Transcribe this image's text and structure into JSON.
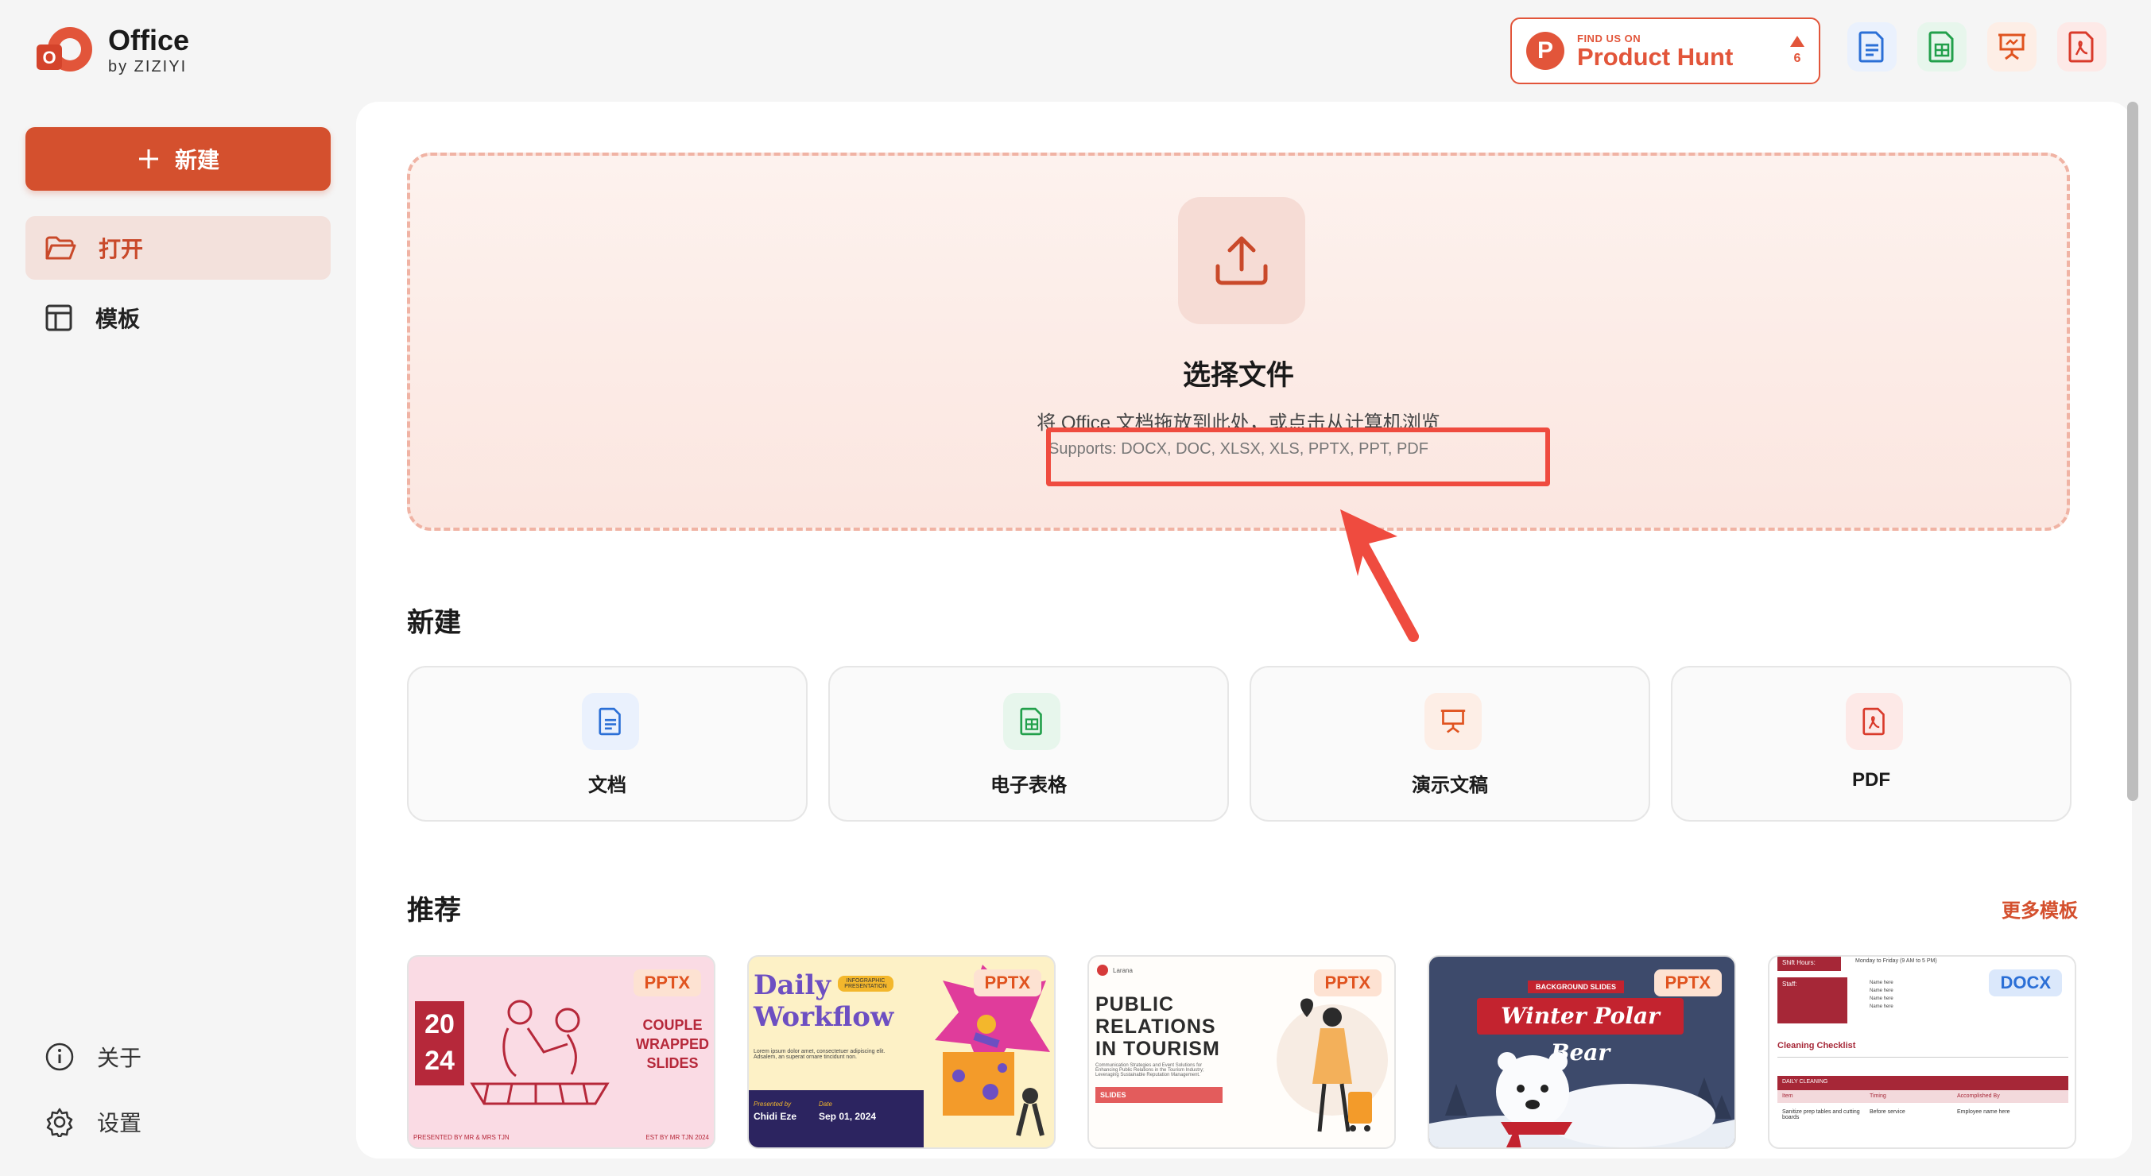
{
  "app": {
    "title": "Office",
    "subtitle": "by ZIZIYI"
  },
  "product_hunt": {
    "find_us": "FIND US ON",
    "name": "Product Hunt",
    "votes": "6",
    "logo_letter": "P"
  },
  "top_icons": [
    "document-icon",
    "spreadsheet-icon",
    "presentation-icon",
    "pdf-icon"
  ],
  "sidebar": {
    "new_label": "新建",
    "items": [
      {
        "label": "打开",
        "icon": "folder-open-icon",
        "active": true
      },
      {
        "label": "模板",
        "icon": "template-icon",
        "active": false
      }
    ],
    "bottom": [
      {
        "label": "关于",
        "icon": "info-icon"
      },
      {
        "label": "设置",
        "icon": "gear-icon"
      }
    ]
  },
  "dropzone": {
    "title": "选择文件",
    "description": "将 Office 文档拖放到此处，或点击从计算机浏览",
    "supports": "Supports: DOCX, DOC, XLSX, XLS, PPTX, PPT, PDF"
  },
  "new_section": {
    "title": "新建",
    "cards": [
      {
        "label": "文档",
        "icon": "document-icon",
        "color": "#2b6fd6"
      },
      {
        "label": "电子表格",
        "icon": "spreadsheet-icon",
        "color": "#22a04b"
      },
      {
        "label": "演示文稿",
        "icon": "presentation-icon",
        "color": "#e0531f"
      },
      {
        "label": "PDF",
        "icon": "pdf-icon",
        "color": "#d93a2b"
      }
    ]
  },
  "recommend": {
    "title": "推荐",
    "more": "更多模板",
    "templates": [
      {
        "tag": "PPTX",
        "year_top": "20",
        "year_bottom": "24",
        "text": "COUPLE\nWRAPPED\nSLIDES",
        "footer_left": "PRESENTED BY MR & MRS TJN",
        "footer_right": "EST BY MR TJN 2024"
      },
      {
        "tag": "PPTX",
        "title_1": "Daily",
        "title_2": "Workflow",
        "badge": "INFOGRAPHIC PRESENTATION",
        "body": "Lorem ipsum dolor amet, consectetuer adipiscing elit. Adsalem, an superat ornare tincidunt non.",
        "presented_by_label": "Presented by",
        "presenter": "Chidi Eze",
        "date_label": "Date",
        "date": "Sep 01, 2024"
      },
      {
        "tag": "PPTX",
        "title": "PUBLIC\nRELATIONS\nIN TOURISM",
        "body": "Communication Strategies and Event Solutions for Enhancing Public Relations in the Tourism Industry; Leveraging Sustainable Reputation Management.",
        "button": "SLIDES",
        "brand": "Larana"
      },
      {
        "tag": "PPTX",
        "badge": "BACKGROUND SLIDES",
        "title": "Winter Polar Bear"
      },
      {
        "tag": "DOCX",
        "shift_label": "Shift Hours:",
        "shift_value": "Monday to Friday (9 AM to 5 PM)",
        "staff_label": "Staff:",
        "staff_lines": [
          "Name here",
          "Name here",
          "Name here",
          "Name here"
        ],
        "heading": "Cleaning Checklist",
        "section": "DAILY CLEANING",
        "cols": [
          "Item",
          "Timing",
          "Accomplished By"
        ],
        "row": [
          "Sanitize prep tables and cutting boards",
          "Before service",
          "Employee name here"
        ]
      }
    ]
  }
}
